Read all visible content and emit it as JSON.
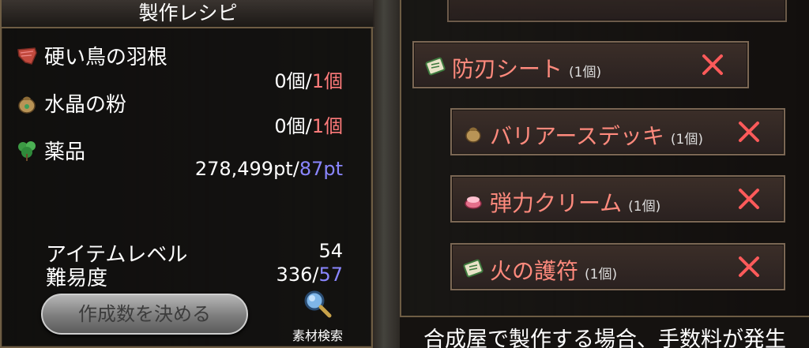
{
  "recipe_panel": {
    "title": "製作レシピ",
    "materials": [
      {
        "name": "硬い鳥の羽根",
        "icon": "feather-icon",
        "have": "0個",
        "sep": "/",
        "need": "1個"
      },
      {
        "name": "水晶の粉",
        "icon": "pouch-icon",
        "have": "0個",
        "sep": "/",
        "need": "1個"
      },
      {
        "name": "薬品",
        "icon": "herb-icon",
        "have": "278,499pt",
        "sep": "/",
        "need": "87pt"
      }
    ],
    "item_level_label": "アイテムレベル",
    "item_level_value": "54",
    "difficulty_label": "難易度",
    "difficulty_value": "336",
    "difficulty_sep": "/",
    "difficulty_max": "57",
    "make_count_button": "作成数を決める",
    "material_search_label": "素材検索"
  },
  "queue_panel": {
    "items": [
      {
        "name": "防刃シート",
        "count": "(1個)",
        "icon": "scroll-icon"
      },
      {
        "name": "バリアースデッキ",
        "count": "(1個)",
        "icon": "pouch-icon"
      },
      {
        "name": "弾力クリーム",
        "count": "(1個)",
        "icon": "cream-icon"
      },
      {
        "name": "火の護符",
        "count": "(1個)",
        "icon": "scroll-icon"
      }
    ],
    "footer_text": "合成屋で製作する場合、手数料が発生"
  },
  "colors": {
    "required_red": "#ff7b7b",
    "points_blue": "#8a86ff",
    "item_name_red": "#ff8a7d",
    "close_red": "#ff5a5a"
  }
}
